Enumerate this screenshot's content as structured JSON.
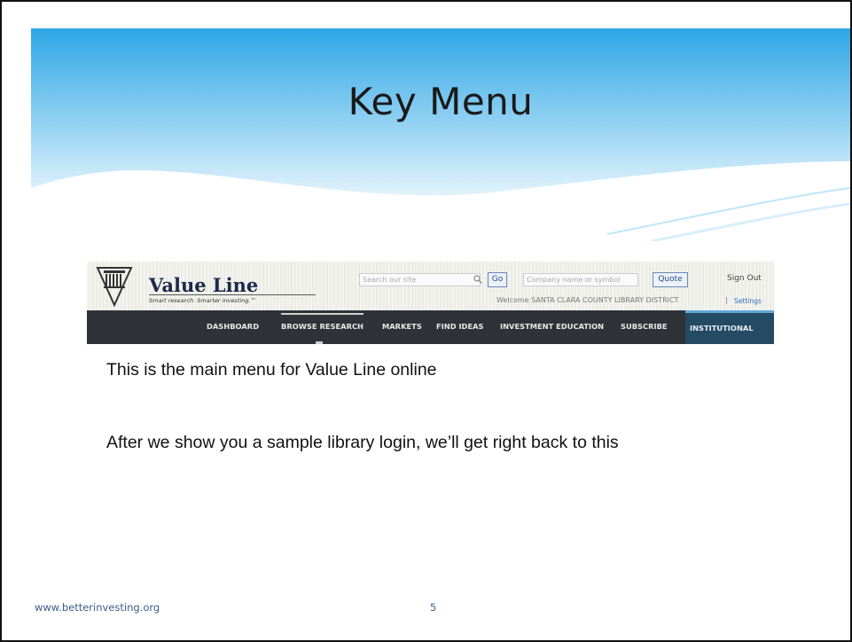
{
  "slide": {
    "title": "Key Menu",
    "body_lines": [
      "This is the main menu for Value Line online",
      "After we show you a sample library login, we’ll get right back to this"
    ],
    "footer_url": "www.betterinvesting.org",
    "page_number": "5",
    "colors": {
      "header_top": "#2ea6e6",
      "header_bottom": "#cdebfa",
      "footer_text": "#3a5f8a"
    }
  },
  "screenshot": {
    "logo": {
      "icon": "value-line-temple-icon",
      "name": "Value Line",
      "tagline": "Smart research. Smarter investing.™"
    },
    "search": {
      "placeholder": "Search our site",
      "go_label": "Go",
      "icon": "search-icon"
    },
    "quote": {
      "placeholder": "Company name or symbol",
      "button_label": "Quote"
    },
    "sign_out_label": "Sign Out",
    "welcome_text": "Welcome SANTA CLARA COUNTY LIBRARY DISTRICT",
    "separator": "|",
    "settings_label": "Settings",
    "nav": {
      "items": [
        "DASHBOARD",
        "BROWSE RESEARCH",
        "MARKETS",
        "FIND IDEAS",
        "INVESTMENT EDUCATION",
        "SUBSCRIBE"
      ],
      "active": "BROWSE RESEARCH",
      "institutional_label": "INSTITUTIONAL"
    }
  }
}
